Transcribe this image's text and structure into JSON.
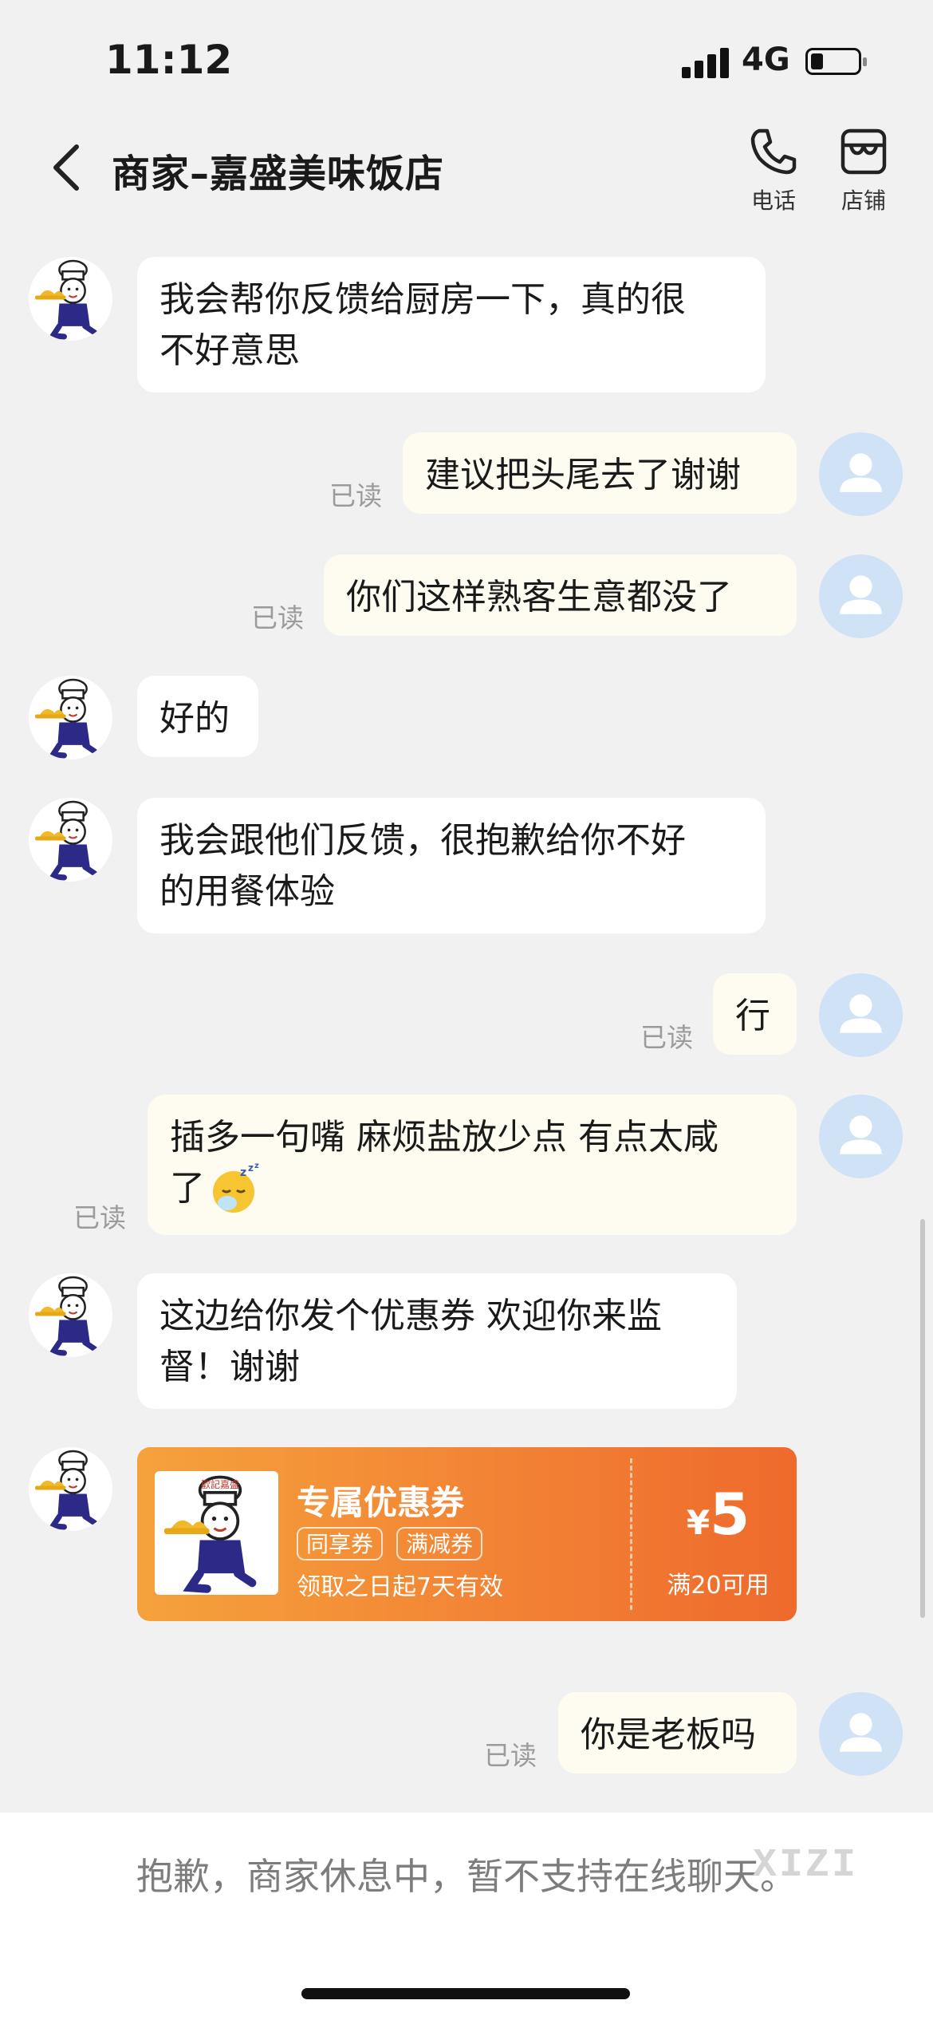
{
  "status_bar": {
    "time": "11:12",
    "network": "4G",
    "battery_level": 0.25
  },
  "header": {
    "title": "商家–嘉盛美味饭店",
    "phone_label": "电话",
    "store_label": "店铺"
  },
  "read_label": "已读",
  "messages": [
    {
      "from": "merchant",
      "text": "我会帮你反馈给厨房一下，真的很\n不好意思"
    },
    {
      "from": "user",
      "text": "建议把头尾去了谢谢"
    },
    {
      "from": "user",
      "text": "你们这样熟客生意都没了"
    },
    {
      "from": "merchant",
      "text": "好的"
    },
    {
      "from": "merchant",
      "text": "我会跟他们反馈，很抱歉给你不好\n的用餐体验"
    },
    {
      "from": "user",
      "text": "行"
    },
    {
      "from": "user",
      "text": "插多一句嘴 麻烦盐放少点 有点太咸\n了",
      "emoji": "sleeping-face-emoji"
    },
    {
      "from": "merchant",
      "text": "这边给你发个优惠券 欢迎你来监\n督！谢谢"
    },
    {
      "from": "user",
      "text": "你是老板吗"
    }
  ],
  "coupon": {
    "logo_text": "歡記嘉盛",
    "title": "专属优惠券",
    "tags": [
      "同享券",
      "满减券"
    ],
    "validity": "领取之日起7天有效",
    "currency": "¥",
    "amount": "5",
    "condition": "满20可用"
  },
  "footer": {
    "notice": "抱歉，商家休息中，暂不支持在线聊天。"
  },
  "watermark": "XIZI",
  "colors": {
    "coupon_orange": "#f28034",
    "user_bubble": "#fefcf0",
    "avatar_blue": "#cfe2f6"
  }
}
